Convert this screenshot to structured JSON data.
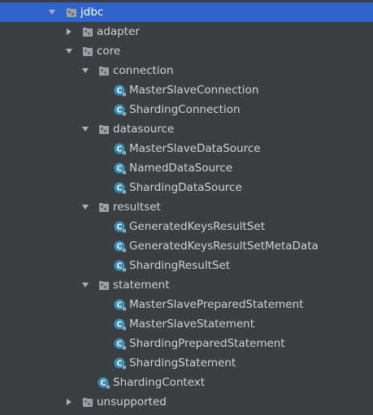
{
  "colors": {
    "background": "#3c3f41",
    "selection": "#2f65ca",
    "text": "#d0d2d4",
    "arrow": "#a9b0b6",
    "package_icon": "#9aa0a6",
    "class_icon": "#3d8fb7"
  },
  "tree": {
    "jdbc": {
      "label": "jdbc",
      "icon": "package-icon",
      "expanded": true,
      "selected": true
    },
    "adapter": {
      "label": "adapter",
      "icon": "package-icon",
      "expanded": false
    },
    "core": {
      "label": "core",
      "icon": "package-icon",
      "expanded": true
    },
    "connection": {
      "label": "connection",
      "icon": "package-icon",
      "expanded": true,
      "classes": [
        "MasterSlaveConnection",
        "ShardingConnection"
      ]
    },
    "datasource": {
      "label": "datasource",
      "icon": "package-icon",
      "expanded": true,
      "classes": [
        "MasterSlaveDataSource",
        "NamedDataSource",
        "ShardingDataSource"
      ]
    },
    "resultset": {
      "label": "resultset",
      "icon": "package-icon",
      "expanded": true,
      "classes": [
        "GeneratedKeysResultSet",
        "GeneratedKeysResultSetMetaData",
        "ShardingResultSet"
      ]
    },
    "statement": {
      "label": "statement",
      "icon": "package-icon",
      "expanded": true,
      "classes": [
        "MasterSlavePreparedStatement",
        "MasterSlaveStatement",
        "ShardingPreparedStatement",
        "ShardingStatement"
      ]
    },
    "sharding_context": {
      "label": "ShardingContext",
      "icon": "class-icon"
    },
    "unsupported": {
      "label": "unsupported",
      "icon": "package-icon",
      "expanded": false
    }
  }
}
